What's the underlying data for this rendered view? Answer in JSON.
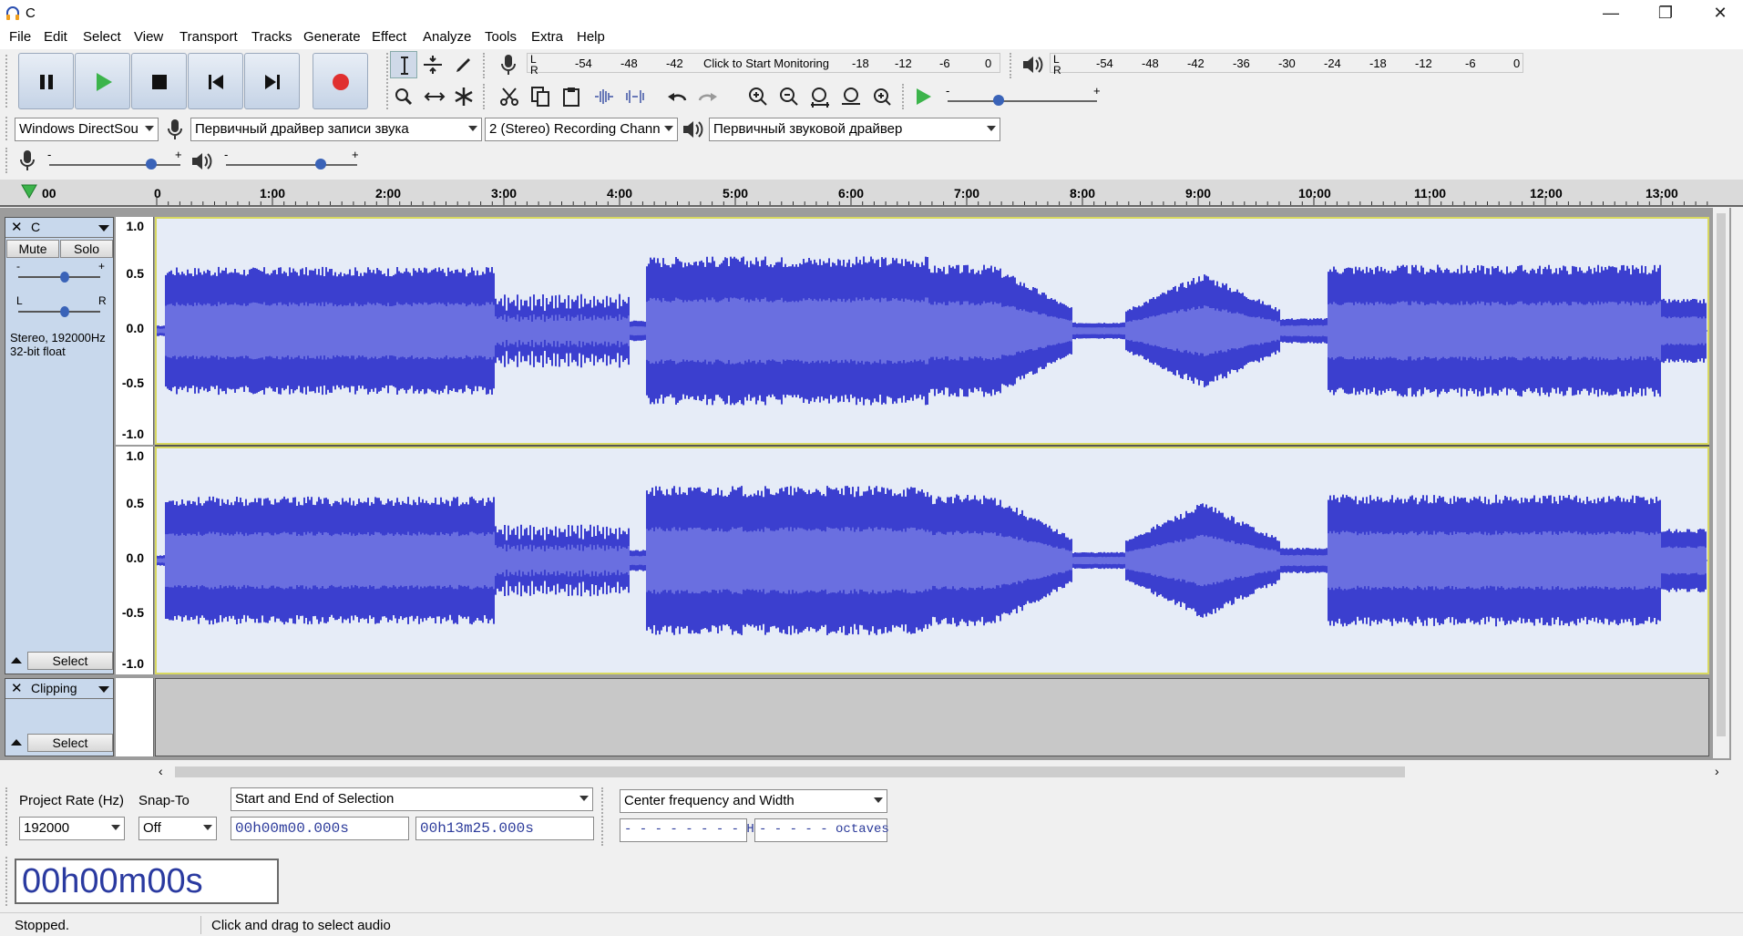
{
  "window": {
    "title": "C",
    "minimize": "—",
    "restore": "❐",
    "close": "✕"
  },
  "menu": [
    "File",
    "Edit",
    "Select",
    "View",
    "Transport",
    "Tracks",
    "Generate",
    "Effect",
    "Analyze",
    "Tools",
    "Extra",
    "Help"
  ],
  "recording_meter": {
    "lr": [
      "L",
      "R"
    ],
    "ticks": [
      "-54",
      "-48",
      "-42",
      "Click to Start Monitoring",
      "-18",
      "-12",
      "-6",
      "0"
    ]
  },
  "playback_meter": {
    "lr": [
      "L",
      "R"
    ],
    "ticks": [
      "-54",
      "-48",
      "-42",
      "-36",
      "-30",
      "-24",
      "-18",
      "-12",
      "-6",
      "0"
    ]
  },
  "device_toolbar": {
    "host": "Windows DirectSou",
    "recording_device": "Первичный драйвер записи звука",
    "channels": "2 (Stereo) Recording Chann",
    "playback_device": "Первичный звуковой драйвер"
  },
  "sliders": {
    "minus": "-",
    "plus": "+"
  },
  "ruler": {
    "labels": [
      "00",
      "0",
      "1:00",
      "2:00",
      "3:00",
      "4:00",
      "5:00",
      "6:00",
      "7:00",
      "8:00",
      "9:00",
      "10:00",
      "11:00",
      "12:00",
      "13:00"
    ]
  },
  "audio_track": {
    "name": "C",
    "mute": "Mute",
    "solo": "Solo",
    "pan_l": "L",
    "pan_r": "R",
    "info1": "Stereo, 192000Hz",
    "info2": "32-bit float",
    "select": "Select",
    "yticks": [
      "1.0",
      "0.5",
      "0.0",
      "-0.5",
      "-1.0"
    ]
  },
  "label_track": {
    "name": "Clipping",
    "select": "Select"
  },
  "selection_toolbar": {
    "rate_label": "Project Rate (Hz)",
    "rate_value": "192000",
    "snap_label": "Snap-To",
    "snap_value": "Off",
    "sel_mode": "Start and End of Selection",
    "start_time": "00h00m00.000s",
    "end_time": "00h13m25.000s"
  },
  "spectral_toolbar": {
    "mode": "Center frequency and Width",
    "freq": "- - - - - - - - Hz",
    "width": "- - - - - octaves"
  },
  "audio_position": "00h00m00s",
  "status": {
    "state": "Stopped.",
    "hint": "Click and drag to select audio"
  },
  "colors": {
    "wave": "#3b3fcf",
    "wave_rms": "#6a6fe0",
    "wave_bg": "#e6ecf7",
    "record": "#e03030",
    "play": "#3cb44b"
  }
}
